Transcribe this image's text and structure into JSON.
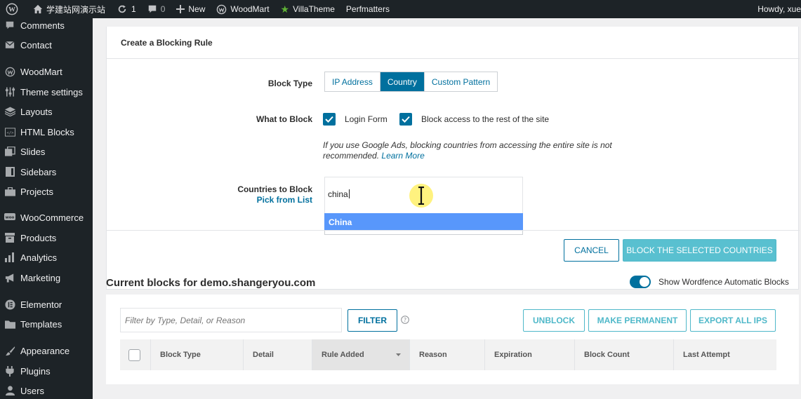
{
  "admin_bar": {
    "site_name": "学建站网演示站",
    "updates_count": "1",
    "comments_count": "0",
    "new_label": "New",
    "woodmart_label": "WoodMart",
    "villatheme_label": "VillaTheme",
    "perfmatters_label": "Perfmatters",
    "howdy_label": "Howdy, xue"
  },
  "sidebar": {
    "items": [
      {
        "label": "Comments",
        "icon": "comment-icon"
      },
      {
        "label": "Contact",
        "icon": "mail-icon"
      },
      {
        "label": "WoodMart",
        "icon": "woodmart-icon"
      },
      {
        "label": "Theme settings",
        "icon": "sliders-icon"
      },
      {
        "label": "Layouts",
        "icon": "layers-icon"
      },
      {
        "label": "HTML Blocks",
        "icon": "html-icon"
      },
      {
        "label": "Slides",
        "icon": "slides-icon"
      },
      {
        "label": "Sidebars",
        "icon": "sidebar-icon"
      },
      {
        "label": "Projects",
        "icon": "briefcase-icon"
      },
      {
        "label": "WooCommerce",
        "icon": "woo-icon"
      },
      {
        "label": "Products",
        "icon": "archive-icon"
      },
      {
        "label": "Analytics",
        "icon": "bar-chart-icon"
      },
      {
        "label": "Marketing",
        "icon": "megaphone-icon"
      },
      {
        "label": "Elementor",
        "icon": "elementor-icon"
      },
      {
        "label": "Templates",
        "icon": "folder-icon"
      },
      {
        "label": "Appearance",
        "icon": "paintbrush-icon"
      },
      {
        "label": "Plugins",
        "icon": "plug-icon"
      },
      {
        "label": "Users",
        "icon": "user-icon"
      }
    ]
  },
  "rule_form": {
    "title": "Create a Blocking Rule",
    "block_type_label": "Block Type",
    "block_type_options": [
      "IP Address",
      "Country",
      "Custom Pattern"
    ],
    "block_type_selected": "Country",
    "what_to_block_label": "What to Block",
    "login_form_label": "Login Form",
    "block_rest_label": "Block access to the rest of the site",
    "ads_note": "If you use Google Ads, blocking countries from accessing the entire site is not recommended.",
    "learn_more": "Learn More",
    "countries_label": "Countries to Block",
    "pick_from_list": "Pick from List",
    "country_input_value": "china",
    "suggestion": "China",
    "cancel_label": "CANCEL",
    "block_countries_label": "BLOCK THE SELECTED COUNTRIES"
  },
  "current_blocks": {
    "title": "Current blocks for demo.shangeryou.com",
    "toggle_label": "Show Wordfence Automatic Blocks",
    "filter_placeholder": "Filter by Type, Detail, or Reason",
    "filter_button": "FILTER",
    "unblock_button": "UNBLOCK",
    "make_permanent_button": "MAKE PERMANENT",
    "export_button": "EXPORT ALL IPS",
    "columns": [
      "Block Type",
      "Detail",
      "Rule Added",
      "Reason",
      "Expiration",
      "Block Count",
      "Last Attempt"
    ]
  },
  "colors": {
    "accent": "#00709e",
    "teal": "#59c0d0",
    "suggestion_highlight": "#5897fb",
    "admin_dark": "#1d2327"
  }
}
